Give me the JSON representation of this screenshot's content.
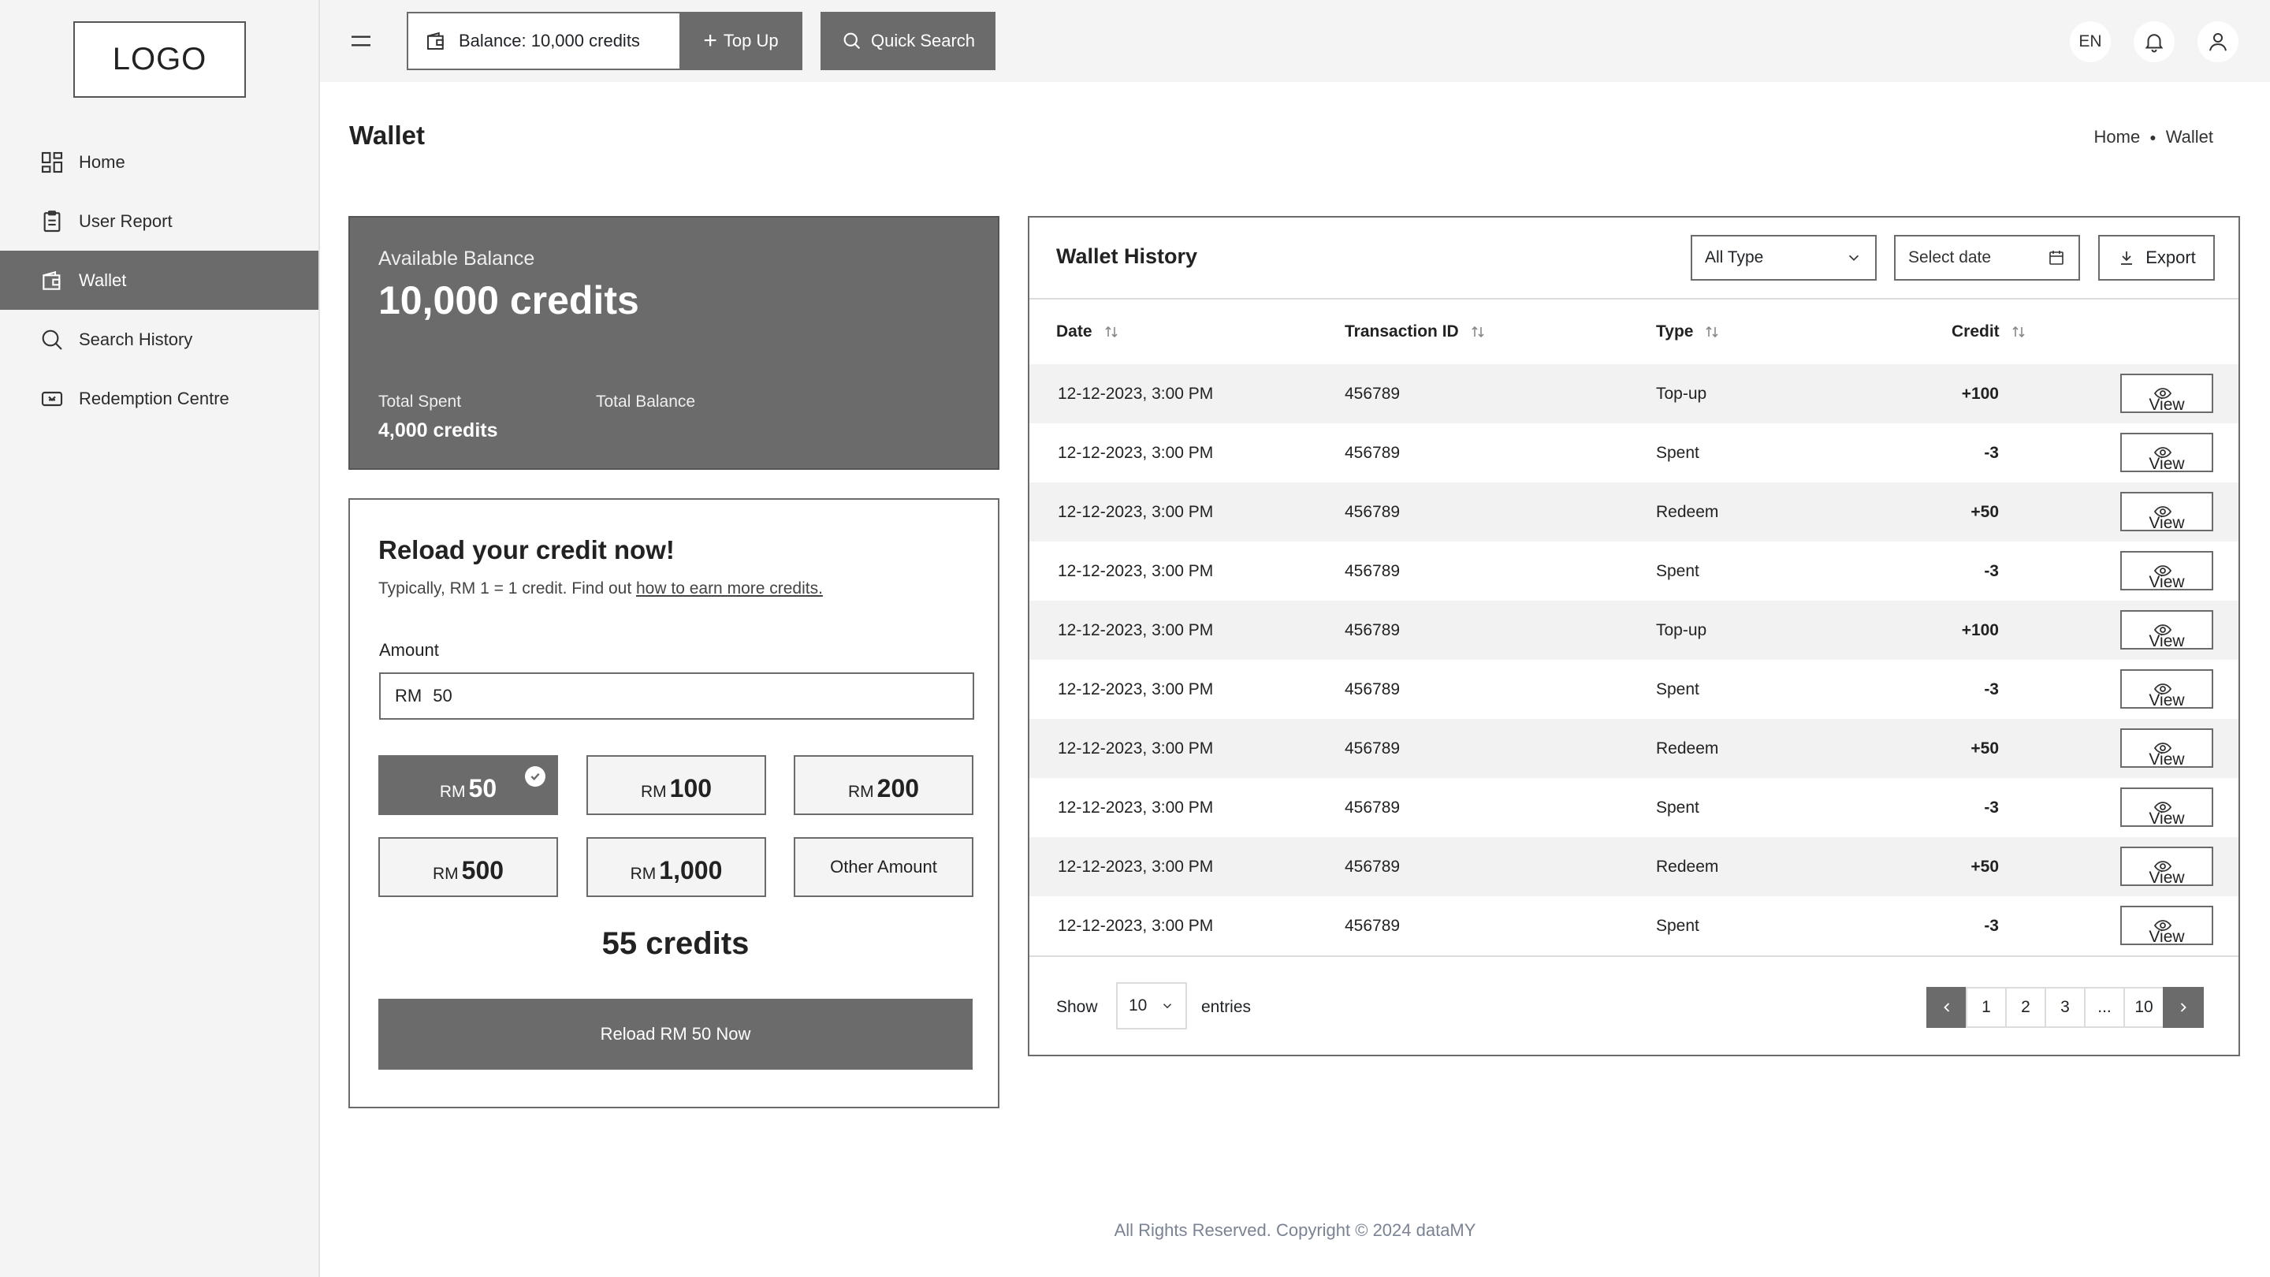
{
  "logo": "LOGO",
  "sidebar": {
    "items": [
      {
        "label": "Home",
        "icon": "grid-icon",
        "active": false
      },
      {
        "label": "User Report",
        "icon": "clipboard-icon",
        "active": false
      },
      {
        "label": "Wallet",
        "icon": "wallet-icon",
        "active": true
      },
      {
        "label": "Search History",
        "icon": "search-icon",
        "active": false
      },
      {
        "label": "Redemption Centre",
        "icon": "ticket-icon",
        "active": false
      }
    ]
  },
  "topbar": {
    "balance_label": "Balance: 10,000 credits",
    "topup_label": "Top Up",
    "quick_search_label": "Quick Search",
    "language": "EN"
  },
  "page": {
    "title": "Wallet",
    "breadcrumb": [
      "Home",
      "Wallet"
    ]
  },
  "balance_card": {
    "available_label": "Available Balance",
    "available_value": "10,000 credits",
    "total_spent_label": "Total Spent",
    "total_spent_value": "4,000 credits",
    "total_balance_label": "Total Balance"
  },
  "reload": {
    "title": "Reload your credit now!",
    "subtitle": "Typically, RM 1 = 1 credit. Find out ",
    "subtitle_link": "how to earn more credits.",
    "amount_label": "Amount",
    "currency": "RM",
    "amount_value": "50",
    "options": [
      {
        "currency": "RM",
        "value": "50",
        "selected": true
      },
      {
        "currency": "RM",
        "value": "100",
        "selected": false
      },
      {
        "currency": "RM",
        "value": "200",
        "selected": false
      },
      {
        "currency": "RM",
        "value": "500",
        "selected": false
      },
      {
        "currency": "RM",
        "value": "1,000",
        "selected": false
      }
    ],
    "other_label": "Other Amount",
    "credits_result": "55 credits",
    "submit_label": "Reload RM 50 Now"
  },
  "history": {
    "title": "Wallet History",
    "type_filter": "All Type",
    "date_placeholder": "Select date",
    "export_label": "Export",
    "columns": [
      "Date",
      "Transaction ID",
      "Type",
      "Credit"
    ],
    "view_label": "View",
    "rows": [
      {
        "date": "12-12-2023, 3:00 PM",
        "id": "456789",
        "type": "Top-up",
        "credit": "+100"
      },
      {
        "date": "12-12-2023, 3:00 PM",
        "id": "456789",
        "type": "Spent",
        "credit": "-3"
      },
      {
        "date": "12-12-2023, 3:00 PM",
        "id": "456789",
        "type": "Redeem",
        "credit": "+50"
      },
      {
        "date": "12-12-2023, 3:00 PM",
        "id": "456789",
        "type": "Spent",
        "credit": "-3"
      },
      {
        "date": "12-12-2023, 3:00 PM",
        "id": "456789",
        "type": "Top-up",
        "credit": "+100"
      },
      {
        "date": "12-12-2023, 3:00 PM",
        "id": "456789",
        "type": "Spent",
        "credit": "-3"
      },
      {
        "date": "12-12-2023, 3:00 PM",
        "id": "456789",
        "type": "Redeem",
        "credit": "+50"
      },
      {
        "date": "12-12-2023, 3:00 PM",
        "id": "456789",
        "type": "Spent",
        "credit": "-3"
      },
      {
        "date": "12-12-2023, 3:00 PM",
        "id": "456789",
        "type": "Redeem",
        "credit": "+50"
      },
      {
        "date": "12-12-2023, 3:00 PM",
        "id": "456789",
        "type": "Spent",
        "credit": "-3"
      }
    ],
    "show_label": "Show",
    "page_size": "10",
    "entries_label": "entries",
    "pages": [
      "1",
      "2",
      "3",
      "...",
      "10"
    ]
  },
  "footer": "All Rights Reserved. Copyright © 2024 dataMY"
}
